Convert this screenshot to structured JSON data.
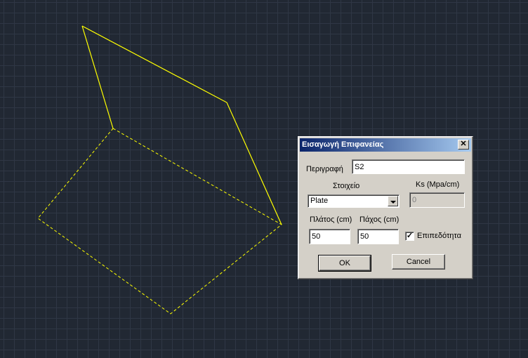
{
  "dialog": {
    "title": "Εισαγωγή Επιφανείας",
    "close_glyph": "✕",
    "description_label": "Περιγραφή",
    "description_value": "S2",
    "element_label": "Στοιχείο",
    "element_value": "Plate",
    "ks_label": "Ks (Mpa/cm)",
    "ks_value": "0",
    "width_label": "Πλάτος (cm)",
    "width_value": "50",
    "thickness_label": "Πάχος (cm)",
    "thickness_value": "50",
    "planarity_label": "Επιπεδότητα",
    "planarity_checked": true,
    "ok_label": "OK",
    "cancel_label": "Cancel"
  },
  "colors": {
    "background": "#212833",
    "grid": "#2f3745",
    "geometry": "#ffff00",
    "titlebar": "#0a246a"
  }
}
